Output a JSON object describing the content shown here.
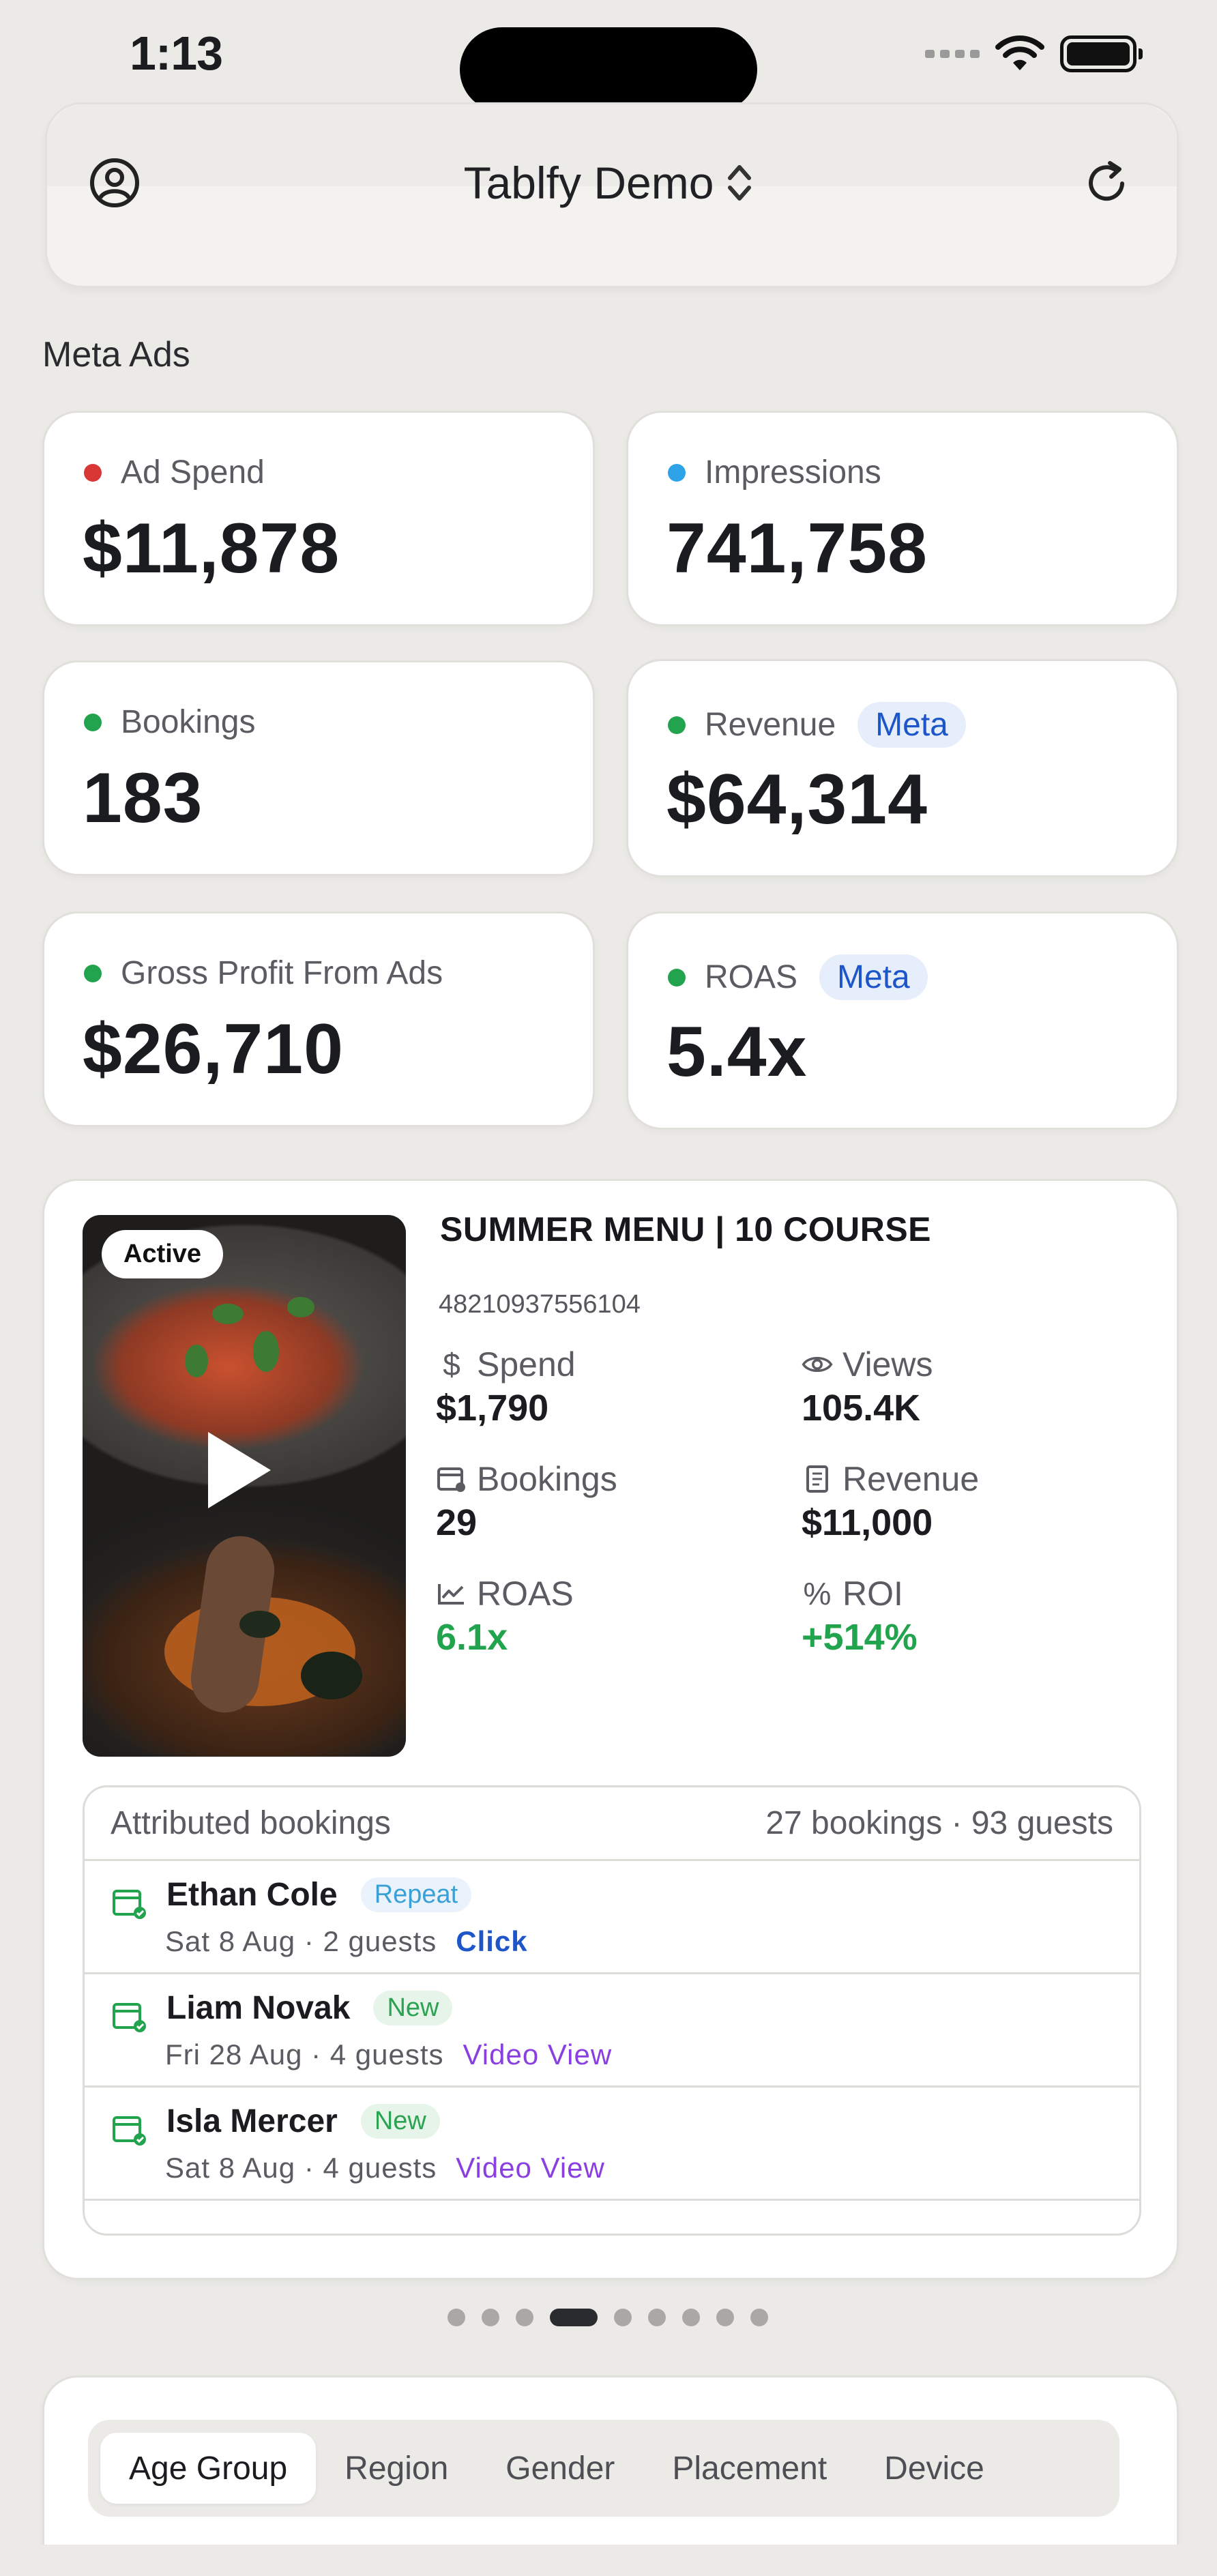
{
  "status_bar": {
    "time": "1:13"
  },
  "header": {
    "title": "Tablfy Demo"
  },
  "section": {
    "title": "Meta Ads"
  },
  "stats": [
    {
      "label": "Ad Spend",
      "value": "$11,878",
      "dot_color": "#d93636",
      "chip": ""
    },
    {
      "label": "Impressions",
      "value": "741,758",
      "dot_color": "#2ea3e8",
      "chip": ""
    },
    {
      "label": "Bookings",
      "value": "183",
      "dot_color": "#22a34d",
      "chip": ""
    },
    {
      "label": "Revenue",
      "value": "$64,314",
      "dot_color": "#22a34d",
      "chip": "Meta"
    },
    {
      "label": "Gross Profit From Ads",
      "value": "$26,710",
      "dot_color": "#22a34d",
      "chip": ""
    },
    {
      "label": "ROAS",
      "value": "5.4x",
      "dot_color": "#22a34d",
      "chip": "Meta"
    }
  ],
  "ad": {
    "status": "Active",
    "title": "SUMMER MENU | 10 COURSE",
    "id": "48210937556104",
    "metrics": {
      "spend": {
        "label": "Spend",
        "value": "$1,790",
        "icon": "dollar-icon"
      },
      "views": {
        "label": "Views",
        "value": "105.4K",
        "icon": "eye-icon"
      },
      "bookings": {
        "label": "Bookings",
        "value": "29",
        "icon": "calendar-icon"
      },
      "revenue": {
        "label": "Revenue",
        "value": "$11,000",
        "icon": "receipt-icon"
      },
      "roas": {
        "label": "ROAS",
        "value": "6.1x",
        "icon": "trend-chart-icon"
      },
      "roi": {
        "label": "ROI",
        "value": "+514%",
        "icon": "percent-icon"
      }
    },
    "attributed": {
      "title": "Attributed bookings",
      "summary": "27 bookings · 93 guests",
      "rows": [
        {
          "name": "Ethan Cole",
          "tag": "Repeat",
          "detail": "Sat 8 Aug · 2 guests",
          "source": "Click"
        },
        {
          "name": "Liam Novak",
          "tag": "New",
          "detail": "Fri 28 Aug · 4 guests",
          "source": "Video View"
        },
        {
          "name": "Isla Mercer",
          "tag": "New",
          "detail": "Sat 8 Aug · 4 guests",
          "source": "Video View"
        }
      ]
    }
  },
  "pager": {
    "count": 9,
    "active_index": 3
  },
  "breakdown_tabs": [
    {
      "label": "Age Group",
      "active": true
    },
    {
      "label": "Region",
      "active": false
    },
    {
      "label": "Gender",
      "active": false
    },
    {
      "label": "Placement",
      "active": false
    },
    {
      "label": "Device",
      "active": false
    }
  ],
  "colors": {
    "background": "#ebeae6",
    "green": "#22a34d",
    "blue_link": "#1e55c8",
    "purple_link": "#8a3fe0"
  }
}
